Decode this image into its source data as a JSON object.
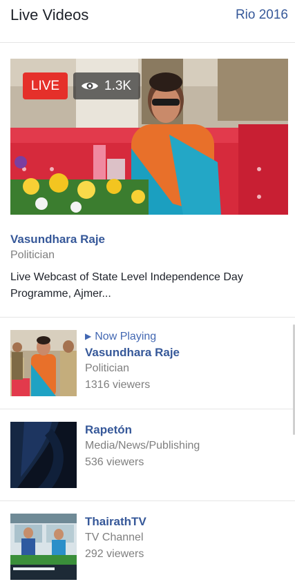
{
  "header": {
    "title": "Live Videos",
    "link": "Rio 2016"
  },
  "featured": {
    "live_label": "LIVE",
    "viewer_count": "1.3K",
    "name": "Vasundhara Raje",
    "category": "Politician",
    "description": "Live Webcast of State Level Independence Day Programme, Ajmer..."
  },
  "list": [
    {
      "status": "Now Playing",
      "name": "Vasundhara Raje",
      "category": "Politician",
      "viewers": "1316 viewers"
    },
    {
      "status": "",
      "name": "Rapetón",
      "category": "Media/News/Publishing",
      "viewers": "536 viewers"
    },
    {
      "status": "",
      "name": "ThairathTV",
      "category": "TV Channel",
      "viewers": "292 viewers"
    }
  ],
  "colors": {
    "link": "#365899",
    "live": "#e5302a",
    "now_playing": "#4267b2",
    "muted": "#7f7f7f"
  },
  "icons": {
    "viewers": "eye-icon",
    "now_playing": "play-triangle-icon"
  }
}
